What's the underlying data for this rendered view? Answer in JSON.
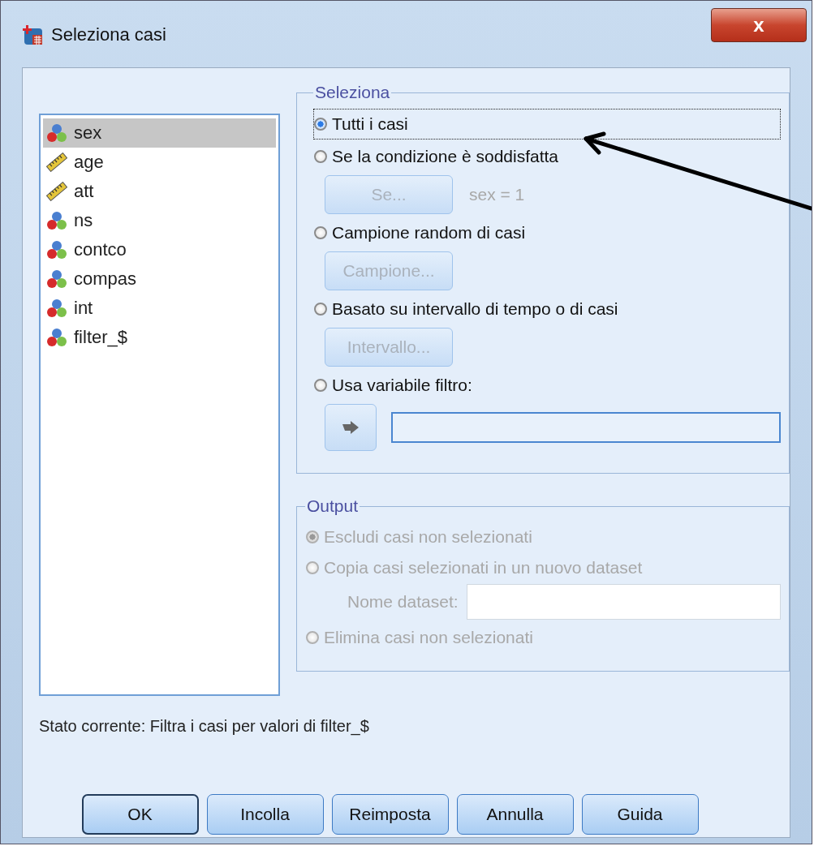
{
  "window": {
    "title": "Seleziona casi"
  },
  "variables": [
    {
      "name": "sex",
      "kind": "nominal",
      "selected": true
    },
    {
      "name": "age",
      "kind": "scale",
      "selected": false
    },
    {
      "name": "att",
      "kind": "scale",
      "selected": false
    },
    {
      "name": "ns",
      "kind": "nominal",
      "selected": false
    },
    {
      "name": "contco",
      "kind": "nominal",
      "selected": false
    },
    {
      "name": "compas",
      "kind": "nominal",
      "selected": false
    },
    {
      "name": "int",
      "kind": "nominal",
      "selected": false
    },
    {
      "name": "filter_$",
      "kind": "nominal",
      "selected": false
    }
  ],
  "select_group": {
    "title": "Seleziona",
    "options": [
      {
        "label": "Tutti i casi",
        "kind": "plain",
        "selected": true,
        "focused": true
      },
      {
        "label": "Se la condizione è soddisfatta",
        "kind": "button",
        "selected": false,
        "focused": false,
        "button": {
          "label": "Se...",
          "disabled": true
        },
        "note": "sex = 1"
      },
      {
        "label": "Campione random di casi",
        "kind": "button",
        "selected": false,
        "focused": false,
        "button": {
          "label": "Campione...",
          "disabled": true
        }
      },
      {
        "label": "Basato su intervallo di tempo o di casi",
        "kind": "button",
        "selected": false,
        "focused": false,
        "button": {
          "label": "Intervallo...",
          "disabled": true
        }
      },
      {
        "label": "Usa variabile filtro:",
        "kind": "filter",
        "selected": false,
        "focused": false
      }
    ]
  },
  "output_group": {
    "title": "Output",
    "options": [
      {
        "label": "Escludi casi non selezionati",
        "kind": "plain",
        "selected": true,
        "disabled": true
      },
      {
        "label": "Copia casi selezionati in un nuovo dataset",
        "kind": "dataset",
        "selected": false,
        "disabled": true,
        "field_label": "Nome dataset:"
      },
      {
        "label": "Elimina casi non selezionati",
        "kind": "plain",
        "selected": false,
        "disabled": true
      }
    ]
  },
  "status": "Stato corrente: Filtra i casi per valori di filter_$",
  "buttons": [
    {
      "label": "OK",
      "default": true
    },
    {
      "label": "Incolla",
      "default": false
    },
    {
      "label": "Reimposta",
      "default": false
    },
    {
      "label": "Annulla",
      "default": false
    },
    {
      "label": "Guida",
      "default": false
    }
  ],
  "close_label": "x"
}
